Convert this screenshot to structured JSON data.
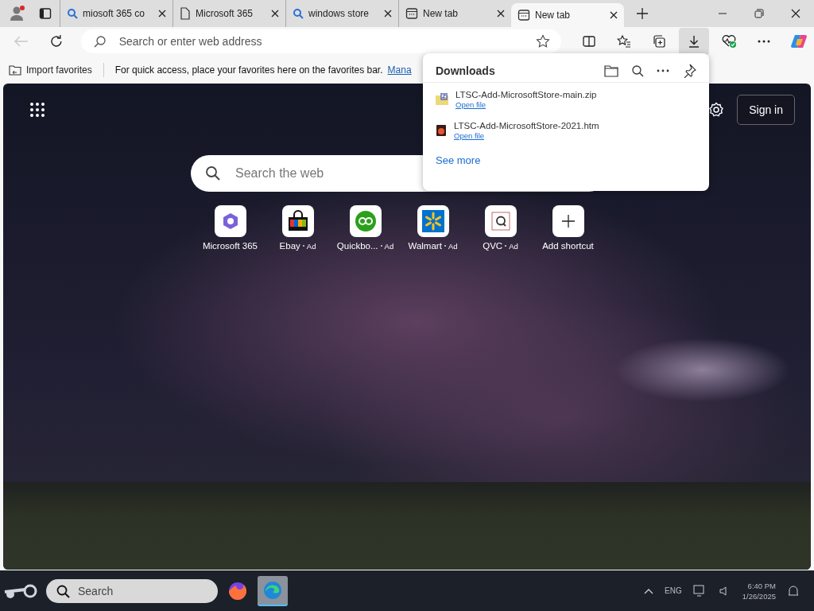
{
  "tabs": [
    {
      "title": "miosoft 365 co",
      "kind": "search",
      "selected": false
    },
    {
      "title": "Microsoft 365",
      "kind": "page",
      "selected": false
    },
    {
      "title": "windows store",
      "kind": "search",
      "selected": false
    },
    {
      "title": "New tab",
      "kind": "newtab",
      "selected": false
    },
    {
      "title": "New tab",
      "kind": "newtab",
      "selected": true
    }
  ],
  "address_bar": {
    "placeholder": "Search or enter web address"
  },
  "toolbar": [
    {
      "kind": "split",
      "pressed": false
    },
    {
      "kind": "favorites",
      "pressed": false
    },
    {
      "kind": "collections",
      "pressed": false
    },
    {
      "kind": "downloads",
      "pressed": true
    },
    {
      "kind": "health",
      "pressed": false
    },
    {
      "kind": "more",
      "pressed": false
    },
    {
      "kind": "copilot",
      "pressed": false
    }
  ],
  "favorites_bar": {
    "import": "Import favorites",
    "message": "For quick access, place your favorites here on the favorites bar.",
    "link": "Mana"
  },
  "downloads": {
    "title": "Downloads",
    "files": [
      {
        "name": "LTSC-Add-MicrosoftStore-main.zip",
        "kind": "zip",
        "action": "Open file"
      },
      {
        "name": "LTSC-Add-MicrosoftStore-2021.htm",
        "kind": "htm",
        "action": "Open file"
      }
    ],
    "see_more": "See more"
  },
  "new_tab": {
    "search_placeholder": "Search the web",
    "sign_in": "Sign in",
    "shortcuts": [
      {
        "label": "Microsoft 365",
        "kind": "m365"
      },
      {
        "label": "Ebay",
        "ad": "Ad",
        "kind": "ebay"
      },
      {
        "label": "Quickbo...",
        "ad": "Ad",
        "kind": "qb"
      },
      {
        "label": "Walmart",
        "ad": "Ad",
        "kind": "walmart"
      },
      {
        "label": "QVC",
        "ad": "Ad",
        "kind": "qvc"
      },
      {
        "label": "Add shortcut",
        "kind": "add"
      }
    ]
  },
  "taskbar": {
    "search_placeholder": "Search",
    "apps": [
      {
        "kind": "firefox",
        "active": false
      },
      {
        "kind": "edge",
        "active": true
      }
    ],
    "language": "ENG",
    "time": "6:40 PM",
    "date": "1/26/2025"
  }
}
